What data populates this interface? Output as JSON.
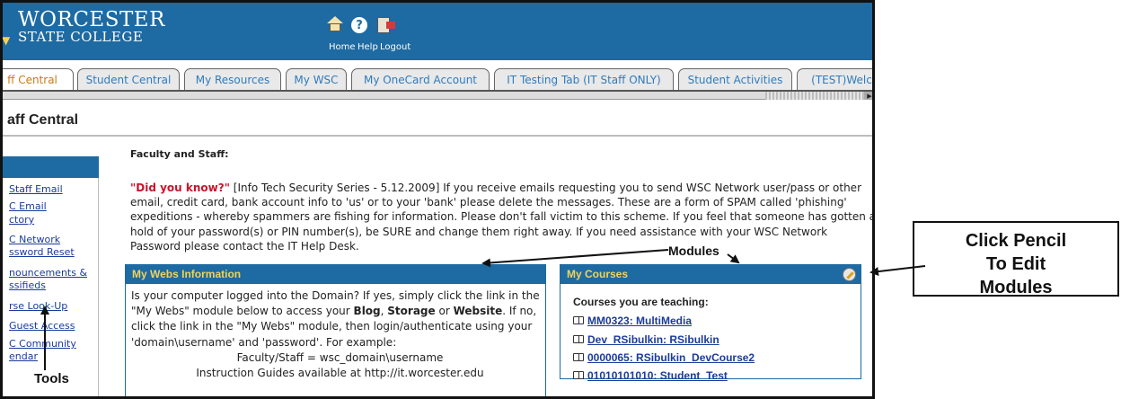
{
  "header": {
    "logo_line1": "WORCESTER",
    "logo_line2": "STATE COLLEGE",
    "nav": {
      "home": "Home",
      "help": "Help",
      "logout": "Logout"
    }
  },
  "tabs": [
    {
      "label": "ff Central",
      "active": true
    },
    {
      "label": "Student Central",
      "active": false
    },
    {
      "label": "My Resources",
      "active": false
    },
    {
      "label": "My WSC",
      "active": false
    },
    {
      "label": "My OneCard Account",
      "active": false
    },
    {
      "label": "IT Testing Tab (IT Staff ONLY)",
      "active": false
    },
    {
      "label": "Student Activities",
      "active": false
    },
    {
      "label": "(TEST)Welc",
      "active": false
    }
  ],
  "page_title": "aff Central",
  "tools": {
    "links": [
      "Staff Email",
      "C Email",
      "ctory",
      "C Network",
      "ssword Reset",
      "nouncements &",
      "ssifieds",
      "rse Look-Up",
      "Guest Access",
      "C Community",
      "endar"
    ]
  },
  "main": {
    "faculty_heading": "Faculty and Staff:",
    "notice": {
      "did_you_know": "\"Did you know?\"",
      "text": " [Info Tech Security Series - 5.12.2009]  If you receive emails requesting you to send WSC Network user/pass or other email, credit card, bank account info to 'us' or to your 'bank' please delete the messages.  These are a form of SPAM called 'phishing' expeditions - whereby spammers are fishing for information.  Please don't fall victim to this scheme.  If you feel that someone has gotten a hold of your password(s) or PIN number(s), be SURE and change them right away.  If you need assistance with your WSC Network Password please contact the IT Help Desk."
    }
  },
  "webs_module": {
    "title": "My Webs Information",
    "p1": "Is your computer logged into the Domain?  If yes, simply click the link in the \"My Webs\" module below to access your ",
    "blog": "Blog",
    "comma": ", ",
    "storage": "Storage",
    "or": " or ",
    "website": "Website",
    "p2": ".  If no, click the link in the \"My Webs\" module, then login/authenticate using your 'domain\\username' and 'password'. For example:",
    "example": "Faculty/Staff  =  wsc_domain\\username",
    "guides": "Instruction Guides available at http://it.worcester.edu"
  },
  "courses_module": {
    "title": "My Courses",
    "subtitle": "Courses you are teaching:",
    "courses": [
      "MM0323: MultiMedia",
      "Dev_RSibulkin: RSibulkin",
      "0000065: RSibulkin_DevCourse2",
      "01010101010: Student_Test"
    ]
  },
  "annotations": {
    "callout_line1": "Click Pencil",
    "callout_line2": "To Edit",
    "callout_line3": "Modules",
    "modules": "Modules",
    "tools": "Tools"
  },
  "colors": {
    "header_blue": "#1e6aa2",
    "module_title_yellow": "#f2d35a",
    "link_blue": "#1a3b9b",
    "alert_red": "#c8142c",
    "active_tab_orange": "#c97b13"
  },
  "icons": [
    "home-icon",
    "help-icon",
    "logout-icon",
    "pencil-icon",
    "book-icon"
  ]
}
